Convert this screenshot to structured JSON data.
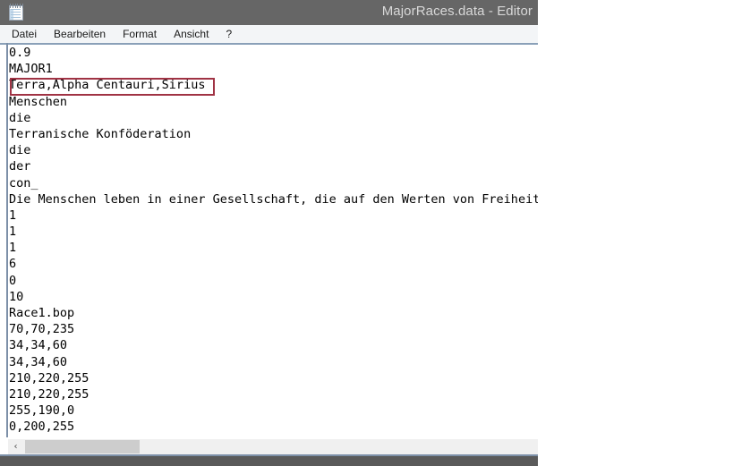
{
  "window": {
    "title": "MajorRaces.data - Editor",
    "icon": "notepad-icon"
  },
  "menu": {
    "items": [
      {
        "label": "Datei"
      },
      {
        "label": "Bearbeiten"
      },
      {
        "label": "Format"
      },
      {
        "label": "Ansicht"
      },
      {
        "label": "?"
      }
    ]
  },
  "document": {
    "lines": [
      "0.9",
      "MAJOR1",
      "Terra,Alpha Centauri,Sirius",
      "Menschen",
      "die",
      "Terranische Konföderation",
      "die",
      "der",
      "con_",
      "Die Menschen leben in einer Gesellschaft, die auf den Werten von Freiheit",
      "1",
      "1",
      "1",
      "6",
      "0",
      "10",
      "Race1.bop",
      "70,70,235",
      "34,34,60",
      "34,34,60",
      "210,220,255",
      "210,220,255",
      "255,190,0",
      "0,200,255"
    ]
  },
  "annotation": {
    "target_line": "Terra,Alpha Centauri,Sirius",
    "color": "#a03344"
  },
  "scrollbar": {
    "left_arrow": "‹",
    "orientation": "horizontal"
  },
  "colors": {
    "titlebar_bg": "#666666",
    "titlebar_text": "#d8d8d8",
    "menubar_bg": "#f3f5f7",
    "client_bg": "#ffffff",
    "frame_accent": "#7d90a8",
    "scroll_track": "#f0f0f0",
    "scroll_thumb": "#cdcdcd",
    "annotation": "#a03344"
  }
}
